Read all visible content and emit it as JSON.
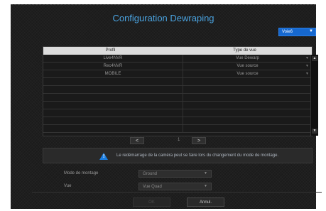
{
  "dialog": {
    "title": "Configuration Dewraping"
  },
  "channel": {
    "selected": "Voie6",
    "arrow": "▼"
  },
  "table": {
    "headers": [
      "Profil",
      "Type de vue"
    ],
    "rows": [
      {
        "profile": "Live4NVR",
        "view": "Vue Dewarp"
      },
      {
        "profile": "Rec4NVR",
        "view": "Vue source"
      },
      {
        "profile": "MOBILE",
        "view": "Vue source"
      }
    ],
    "dropdown_arrow": "▼",
    "scroll_up": "▲",
    "scroll_down": "▼"
  },
  "pager": {
    "prev": "<",
    "page": "1",
    "next": ">"
  },
  "notice": {
    "icon": "warning-icon",
    "icon_glyph": "!",
    "message": "Le redémarrage de la caméra peut se faire lors du changement du mode de montage."
  },
  "mounting": {
    "label": "Mode de montage",
    "value": "Ground",
    "arrow": "▼"
  },
  "view": {
    "label": "Vue",
    "value": "Vue Quad",
    "arrow": "▼"
  },
  "buttons": {
    "ok": "OK",
    "cancel": "Annul."
  },
  "colors": {
    "accent": "#1668cf",
    "title": "#4aa3e0",
    "background": "#1b1b1b"
  }
}
